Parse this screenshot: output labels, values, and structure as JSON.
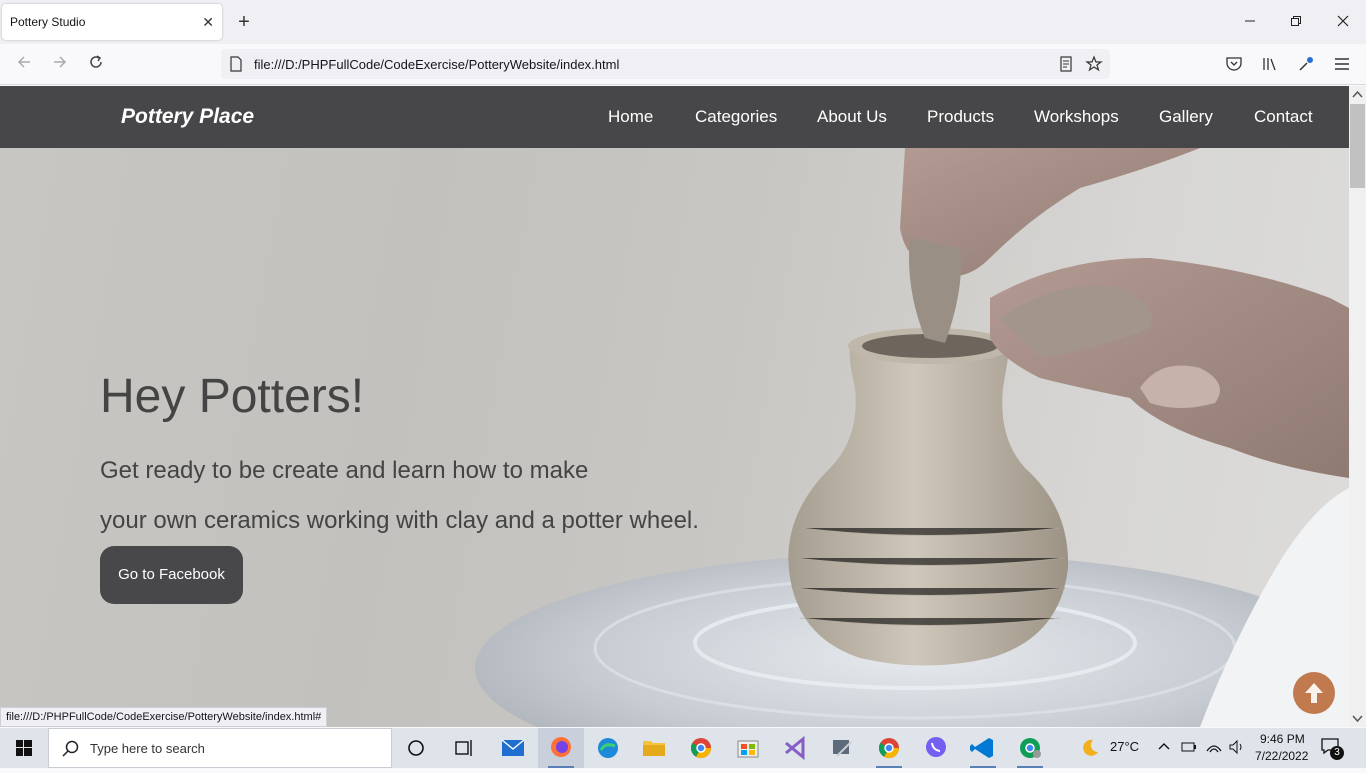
{
  "browser": {
    "tab_title": "Pottery Studio",
    "url": "file:///D:/PHPFullCode/CodeExercise/PotteryWebsite/index.html",
    "status_url": "file:///D:/PHPFullCode/CodeExercise/PotteryWebsite/index.html#"
  },
  "site": {
    "brand": "Pottery Place",
    "menu": [
      "Home",
      "Categories",
      "About Us",
      "Products",
      "Workshops",
      "Gallery",
      "Contact"
    ]
  },
  "hero": {
    "title": "Hey Potters!",
    "line1": "Get ready to be create and learn how to make",
    "line2": "your own ceramics working with clay and a potter wheel.",
    "button_label": "Go to Facebook"
  },
  "taskbar": {
    "search_placeholder": "Type here to search",
    "weather_temp": "27°C",
    "time": "9:46 PM",
    "date": "7/22/2022",
    "notification_count": "3"
  },
  "colors": {
    "header_bg": "#474749",
    "button_bg": "#48484a",
    "to_top": "#c07a4e"
  }
}
